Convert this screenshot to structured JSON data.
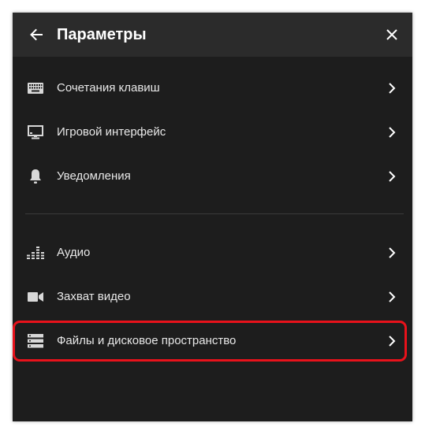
{
  "header": {
    "title": "Параметры",
    "back_icon": "arrow-left-icon",
    "close_icon": "close-icon"
  },
  "menu": {
    "group1": [
      {
        "label": "Сочетания клавиш",
        "icon": "keyboard-icon"
      },
      {
        "label": "Игровой интерфейс",
        "icon": "monitor-icon"
      },
      {
        "label": "Уведомления",
        "icon": "bell-icon"
      }
    ],
    "group2": [
      {
        "label": "Аудио",
        "icon": "audio-equalizer-icon"
      },
      {
        "label": "Захват видео",
        "icon": "video-camera-icon"
      },
      {
        "label": "Файлы и дисковое пространство",
        "icon": "storage-icon",
        "highlighted": true
      }
    ]
  },
  "colors": {
    "panel_bg": "#1d1d1d",
    "header_bg": "#2b2b2b",
    "text": "#e8e8e8",
    "highlight": "#e8121b"
  }
}
